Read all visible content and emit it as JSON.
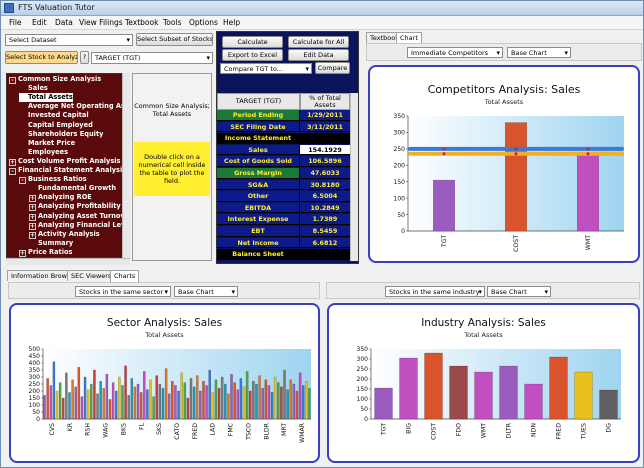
{
  "window": {
    "title": "FTS Valuation Tutor"
  },
  "menu": [
    "File",
    "Edit",
    "Data",
    "View Filings",
    "Textbook",
    "Tools",
    "Options",
    "Help"
  ],
  "toolbar": {
    "select_dataset": "Select Dataset",
    "select_subset": "Select Subset of Stocks",
    "select_stock": "Select Stock to Analyze",
    "help_btn": "?",
    "stock_value": "TARGET (TGT)"
  },
  "tree": [
    {
      "label": "Common Size Analysis",
      "level": 0,
      "box": "-"
    },
    {
      "label": "Sales",
      "level": 1,
      "box": ""
    },
    {
      "label": "Total Assets",
      "level": 1,
      "box": "",
      "selected": true
    },
    {
      "label": "Average Net Operating Assets",
      "level": 1,
      "box": ""
    },
    {
      "label": "Invested Capital",
      "level": 1,
      "box": ""
    },
    {
      "label": "Capital Employed",
      "level": 1,
      "box": ""
    },
    {
      "label": "Shareholders Equity",
      "level": 1,
      "box": ""
    },
    {
      "label": "Market Price",
      "level": 1,
      "box": ""
    },
    {
      "label": "Employees",
      "level": 1,
      "box": ""
    },
    {
      "label": "Cost Volume Profit Analysis",
      "level": 0,
      "box": "+"
    },
    {
      "label": "Financial Statement Analysis",
      "level": 0,
      "box": "-"
    },
    {
      "label": "Business Ratios",
      "level": 1,
      "box": "-"
    },
    {
      "label": "Fundamental Growth",
      "level": 2,
      "box": ""
    },
    {
      "label": "Analyzing ROE",
      "level": 2,
      "box": "+"
    },
    {
      "label": "Analyzing Profitability",
      "level": 2,
      "box": "+"
    },
    {
      "label": "Analyzing Asset Turnover",
      "level": 2,
      "box": "+"
    },
    {
      "label": "Analyzing Financial Leverage",
      "level": 2,
      "box": "+"
    },
    {
      "label": "Activity Analysis",
      "level": 2,
      "box": "+"
    },
    {
      "label": "Summary",
      "level": 2,
      "box": ""
    },
    {
      "label": "Price Ratios",
      "level": 1,
      "box": "+"
    }
  ],
  "middle": {
    "caption": "Common Size Analysis; Total Assets",
    "hint": "Double click on a numerical cell inside the table to plot the field."
  },
  "calc": {
    "calculate": "Calculate",
    "calculate_all": "Calculate for All",
    "export": "Export to Excel",
    "edit": "Edit Data",
    "compare_combo": "Compare TGT to...",
    "compare_btn": "Compare"
  },
  "grid": {
    "col1": "TARGET (TGT)",
    "col2": "% of Total Assets",
    "rows": [
      {
        "label": "Period Ending",
        "value": "1/29/2011",
        "kind": "green"
      },
      {
        "label": "SEC Filing Date",
        "value": "3/11/2011",
        "kind": ""
      },
      {
        "label": "Income Statement",
        "value": "",
        "kind": "sec"
      },
      {
        "label": "Sales",
        "value": "154.1929",
        "kind": "hl"
      },
      {
        "label": "Cost of Goods Sold",
        "value": "106.5896",
        "kind": ""
      },
      {
        "label": "Gross Margin",
        "value": "47.6033",
        "kind": "green"
      },
      {
        "label": "SG&A",
        "value": "30.8180",
        "kind": ""
      },
      {
        "label": "Other",
        "value": "6.5004",
        "kind": ""
      },
      {
        "label": "EBITDA",
        "value": "10.2849",
        "kind": ""
      },
      {
        "label": "Interest Expense",
        "value": "1.7389",
        "kind": ""
      },
      {
        "label": "EBT",
        "value": "8.5459",
        "kind": ""
      },
      {
        "label": "Net Income",
        "value": "6.6812",
        "kind": ""
      },
      {
        "label": "Balance Sheet",
        "value": "",
        "kind": "sec"
      }
    ]
  },
  "right_tabs": [
    "Textbook",
    "Chart"
  ],
  "right_combo1": "Immediate Competitors",
  "right_combo2": "Base Chart",
  "bottom_tabs": [
    "Information Browser",
    "SEC Viewers",
    "Charts"
  ],
  "sector_combo1": "Stocks in the same sector",
  "sector_combo2": "Base Chart",
  "industry_combo1": "Stocks in the same industry",
  "industry_combo2": "Base Chart",
  "chart_data": [
    {
      "type": "bar",
      "title": "Competitors Analysis: Sales",
      "subtitle": "Total Assets",
      "categories": [
        "TGT",
        "COST",
        "WMT"
      ],
      "values": [
        155,
        330,
        235
      ],
      "ylim": [
        0,
        350
      ],
      "yticks": [
        0,
        50,
        100,
        150,
        200,
        250,
        300,
        350
      ],
      "colors": [
        "#9b5cc0",
        "#d9542a",
        "#c04fc0"
      ],
      "lines": [
        {
          "values": [
            250,
            250,
            250
          ],
          "color": "#3a7ad8"
        },
        {
          "values": [
            235,
            235,
            235
          ],
          "color": "#f0b020"
        }
      ]
    },
    {
      "type": "bar",
      "title": "Sector Analysis: Sales",
      "subtitle": "Total Assets",
      "categories": [
        "CVS",
        "KR",
        "RSH",
        "WAG",
        "BKS",
        "FL",
        "SKS",
        "CATO",
        "FRED",
        "LAD",
        "FMC",
        "TSCO",
        "BLDR",
        "MRT",
        "WMAR"
      ],
      "values": [
        170,
        290,
        240,
        410,
        200,
        260,
        150,
        330,
        190,
        280,
        230,
        370,
        160,
        300,
        210,
        250,
        350,
        180,
        270,
        220,
        320,
        140,
        260,
        200,
        300,
        240,
        380,
        170,
        290,
        230,
        250,
        190,
        340,
        210,
        280,
        160,
        310,
        250,
        220,
        360,
        180,
        270,
        240,
        200,
        330,
        260,
        150,
        290,
        230,
        310,
        200,
        270,
        240,
        350,
        190,
        280,
        220,
        300,
        250,
        180,
        320,
        260,
        210,
        290,
        230,
        340,
        200,
        270,
        250,
        310,
        220,
        280,
        240,
        190,
        300,
        260,
        230,
        350,
        210,
        280,
        250,
        200,
        330,
        240,
        270,
        220
      ],
      "ylim": [
        0,
        500
      ],
      "yticks": [
        0,
        50,
        100,
        150,
        200,
        250,
        300,
        350,
        400,
        450,
        500
      ]
    },
    {
      "type": "bar",
      "title": "Industry Analysis: Sales",
      "subtitle": "Total Assets",
      "categories": [
        "TGT",
        "BIG",
        "COST",
        "FDO",
        "WMT",
        "DLTR",
        "NDN",
        "FRED",
        "TUES",
        "DG"
      ],
      "values": [
        155,
        305,
        330,
        265,
        235,
        265,
        175,
        310,
        235,
        145
      ],
      "ylim": [
        0,
        350
      ],
      "yticks": [
        0,
        50,
        100,
        150,
        200,
        250,
        300,
        350
      ],
      "colors": [
        "#9b5cc0",
        "#c04fc0",
        "#d9542a",
        "#9a4a4a",
        "#c04fc0",
        "#9b5cc0",
        "#c04fc0",
        "#d9542a",
        "#e8c020",
        "#606060"
      ]
    }
  ]
}
